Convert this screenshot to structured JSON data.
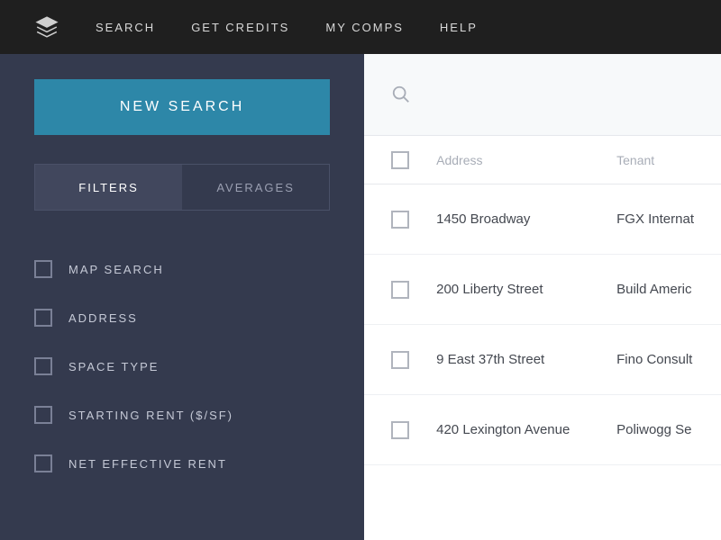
{
  "nav": {
    "items": [
      {
        "label": "SEARCH"
      },
      {
        "label": "GET CREDITS"
      },
      {
        "label": "MY COMPS"
      },
      {
        "label": "HELP"
      }
    ]
  },
  "sidebar": {
    "new_search_label": "NEW SEARCH",
    "tabs": {
      "filters": "FILTERS",
      "averages": "AVERAGES"
    },
    "filters": [
      {
        "label": "MAP SEARCH"
      },
      {
        "label": "ADDRESS"
      },
      {
        "label": "SPACE TYPE"
      },
      {
        "label": "STARTING RENT ($/SF)"
      },
      {
        "label": "NET EFFECTIVE RENT"
      }
    ]
  },
  "table": {
    "headers": {
      "address": "Address",
      "tenant": "Tenant"
    },
    "rows": [
      {
        "address": "1450 Broadway",
        "tenant": "FGX Internat"
      },
      {
        "address": "200 Liberty Street",
        "tenant": "Build Americ"
      },
      {
        "address": "9 East 37th Street",
        "tenant": "Fino Consult"
      },
      {
        "address": "420 Lexington Avenue",
        "tenant": "Poliwogg Se"
      }
    ]
  }
}
